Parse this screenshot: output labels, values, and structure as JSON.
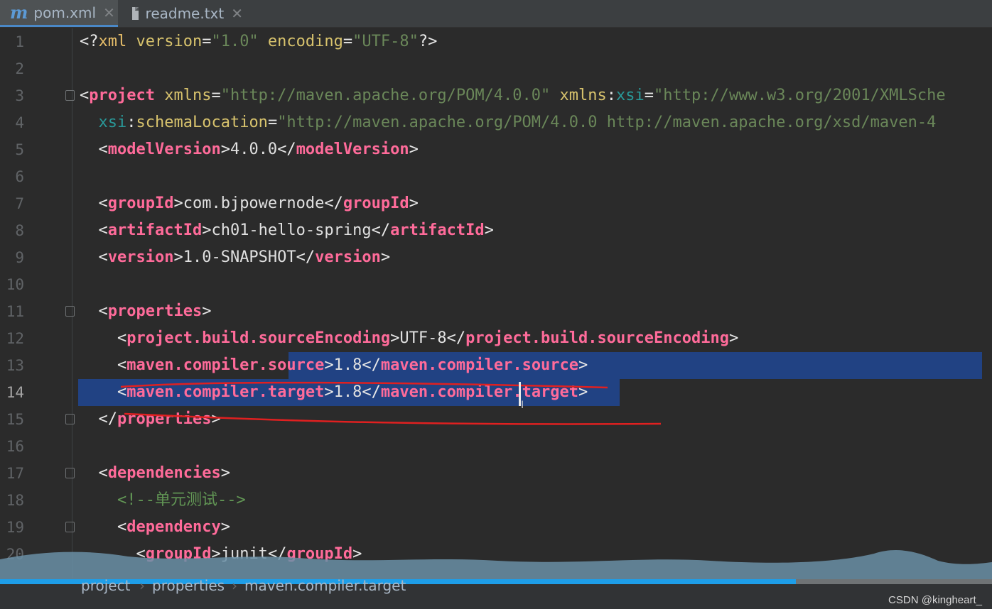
{
  "tabs": [
    {
      "label": "pom.xml",
      "active": true,
      "icon": "maven-icon"
    },
    {
      "label": "readme.txt",
      "active": false,
      "icon": "text-file-icon"
    }
  ],
  "lines": [
    {
      "n": "1",
      "html": "<span class='br'>&lt;?</span><span class='t'>xml </span><span class='attrn'>version</span><span class='br'>=</span><span class='av'>\"1.0\"</span><span class='attrn'> encoding</span><span class='br'>=</span><span class='av'>\"UTF-8\"</span><span class='br'>?&gt;</span>"
    },
    {
      "n": "2",
      "html": ""
    },
    {
      "n": "3",
      "html": "<span class='br'>&lt;</span><span class='tag'>project</span> <span class='attrn'>xmlns</span><span class='br'>=</span><span class='av'>\"http://maven.apache.org/POM/4.0.0\"</span> <span class='attrn'>xmlns</span><span class='br'>:</span><span class='ns'>xsi</span><span class='br'>=</span><span class='av'>\"http://www.w3.org/2001/XMLSche</span>",
      "fold": true
    },
    {
      "n": "4",
      "html": "  <span class='ns'>xsi</span><span class='br'>:</span><span class='attrn'>schemaLocation</span><span class='br'>=</span><span class='av'>\"http://maven.apache.org/POM/4.0.0 http://maven.apache.org/xsd/maven-4</span>"
    },
    {
      "n": "5",
      "html": "  <span class='br'>&lt;</span><span class='tag'>modelVersion</span><span class='br'>&gt;</span><span class='tx'>4.0.0</span><span class='br'>&lt;/</span><span class='tag'>modelVersion</span><span class='br'>&gt;</span>"
    },
    {
      "n": "6",
      "html": ""
    },
    {
      "n": "7",
      "html": "  <span class='br'>&lt;</span><span class='tag'>groupId</span><span class='br'>&gt;</span><span class='tx'>com.bjpowernode</span><span class='br'>&lt;/</span><span class='tag'>groupId</span><span class='br'>&gt;</span>"
    },
    {
      "n": "8",
      "html": "  <span class='br'>&lt;</span><span class='tag'>artifactId</span><span class='br'>&gt;</span><span class='tx'>ch01-hello-spring</span><span class='br'>&lt;/</span><span class='tag'>artifactId</span><span class='br'>&gt;</span>"
    },
    {
      "n": "9",
      "html": "  <span class='br'>&lt;</span><span class='tag'>version</span><span class='br'>&gt;</span><span class='tx'>1.0-SNAPSHOT</span><span class='br'>&lt;/</span><span class='tag'>version</span><span class='br'>&gt;</span>"
    },
    {
      "n": "10",
      "html": ""
    },
    {
      "n": "11",
      "html": "  <span class='br'>&lt;</span><span class='tag'>properties</span><span class='br'>&gt;</span>",
      "fold": true
    },
    {
      "n": "12",
      "html": "    <span class='br'>&lt;</span><span class='tag'>project.build.sourceEncoding</span><span class='br'>&gt;</span><span class='tx'>UTF-8</span><span class='br'>&lt;/</span><span class='tag'>project.build.sourceEncoding</span><span class='br'>&gt;</span>"
    },
    {
      "n": "13",
      "html": "    <span class='br'>&lt;</span><span class='tag'>maven.compiler.source</span><span class='br'>&gt;</span><span class='tx'>1.8</span><span class='br'>&lt;/</span><span class='tag'>maven.compiler.source</span><span class='br'>&gt;</span>"
    },
    {
      "n": "14",
      "html": "    <span class='br'>&lt;</span><span class='tag'>maven.compiler.target</span><span class='br'>&gt;</span><span class='tx'>1.8</span><span class='br'>&lt;/</span><span class='tag'>maven.compiler.target</span><span class='br'>&gt;</span>",
      "current": true
    },
    {
      "n": "15",
      "html": "  <span class='br'>&lt;/</span><span class='tag'>properties</span><span class='br'>&gt;</span>",
      "fold": true
    },
    {
      "n": "16",
      "html": ""
    },
    {
      "n": "17",
      "html": "  <span class='br'>&lt;</span><span class='tag'>dependencies</span><span class='br'>&gt;</span>",
      "fold": true
    },
    {
      "n": "18",
      "html": "    <span class='cm'>&lt;!--单元测试--&gt;</span>"
    },
    {
      "n": "19",
      "html": "    <span class='br'>&lt;</span><span class='tag'>dependency</span><span class='br'>&gt;</span>",
      "fold": true
    },
    {
      "n": "20",
      "html": "      <span class='br'>&lt;</span><span class='tag'>groupId</span><span class='br'>&gt;</span><span class='tx'>junit</span><span class='br'>&lt;/</span><span class='tag'>groupId</span><span class='br'>&gt;</span>"
    }
  ],
  "breadcrumb": [
    "project",
    "properties",
    "maven.compiler.target"
  ],
  "watermark": "CSDN @kingheart_",
  "colors": {
    "selection": "#214283",
    "annotation": "#e02020",
    "progress": "#1e9ee8"
  }
}
